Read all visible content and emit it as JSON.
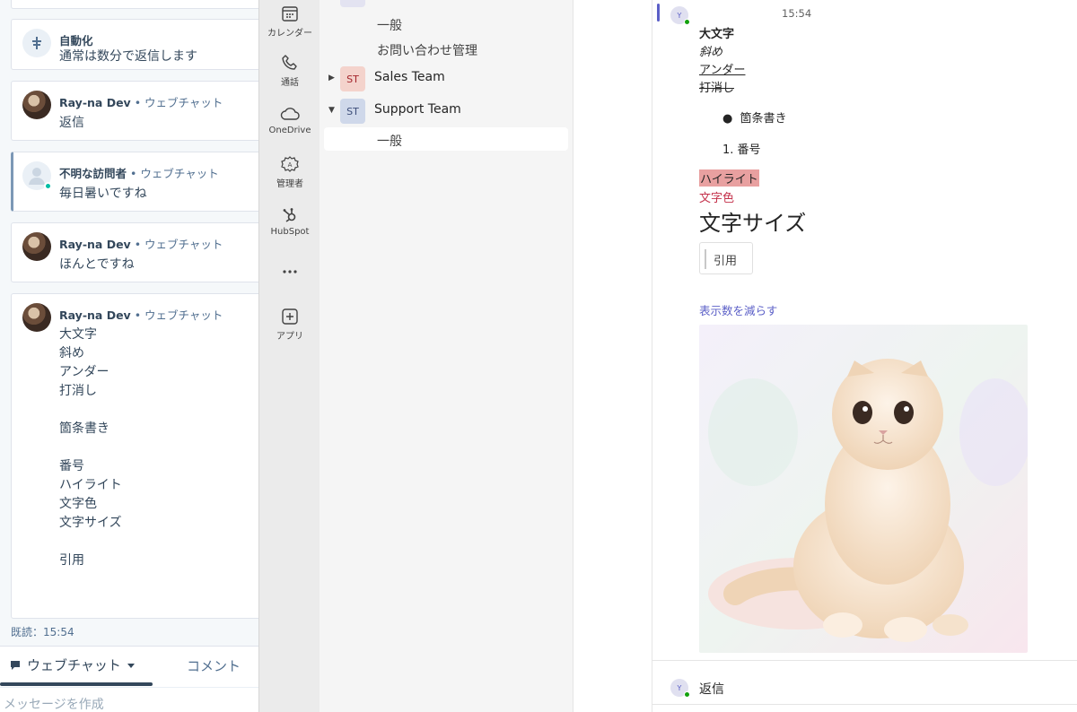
{
  "hubspot": {
    "cards": [
      {
        "sender": "自動化",
        "channel": "",
        "preview": "通常は数分で返信します"
      },
      {
        "sender": "Ray-na Dev",
        "channel": "• ウェブチャット",
        "preview": "返信"
      },
      {
        "sender": "不明な訪問者",
        "channel": "• ウェブチャット",
        "preview": "毎日暑いですね"
      },
      {
        "sender": "Ray-na Dev",
        "channel": "• ウェブチャット",
        "preview": "ほんとですね"
      },
      {
        "sender": "Ray-na Dev",
        "channel": "• ウェブチャット",
        "lines": [
          "大文字",
          "斜め",
          "アンダー",
          "打消し",
          "",
          "箇条書き",
          "",
          "番号",
          "ハイライト",
          "文字色",
          "文字サイズ",
          "",
          "引用"
        ]
      }
    ],
    "read_status": "既読：15:54",
    "tab_webchat": "ウェブチャット",
    "tab_comment": "コメント",
    "composer_placeholder": "メッセージを作成"
  },
  "rail": [
    {
      "label": "カレンダー",
      "icon": "calendar-icon"
    },
    {
      "label": "通話",
      "icon": "phone-icon"
    },
    {
      "label": "OneDrive",
      "icon": "cloud-icon"
    },
    {
      "label": "管理者",
      "icon": "admin-icon"
    },
    {
      "label": "HubSpot",
      "icon": "hubspot-icon"
    },
    {
      "label": "",
      "icon": "more-icon"
    },
    {
      "label": "アプリ",
      "icon": "add-app-icon"
    }
  ],
  "teams_list": {
    "channels_top": [
      "一般",
      "お問い合わせ管理"
    ],
    "teams": [
      {
        "abbr": "ST",
        "name": "Sales Team",
        "color": "#f4d3cc"
      },
      {
        "abbr": "ST",
        "name": "Support Team",
        "color": "#cfd8ea"
      }
    ],
    "support_channels": [
      "一般"
    ]
  },
  "chat": {
    "avatar_initial": "Y",
    "time": "15:54",
    "bold": "大文字",
    "italic": "斜め",
    "underline": "アンダー",
    "strike": "打消し",
    "bullet": "箇条書き",
    "numbered_prefix": "1.",
    "numbered": "番号",
    "highlight": "ハイライト",
    "colored": "文字色",
    "large": "文字サイズ",
    "quote": "引用",
    "show_less": "表示数を減らす",
    "reply": "返信",
    "accent_color": "#5b5fc7",
    "highlight_color": "#e8a0a0",
    "text_color": "#c4314b"
  }
}
